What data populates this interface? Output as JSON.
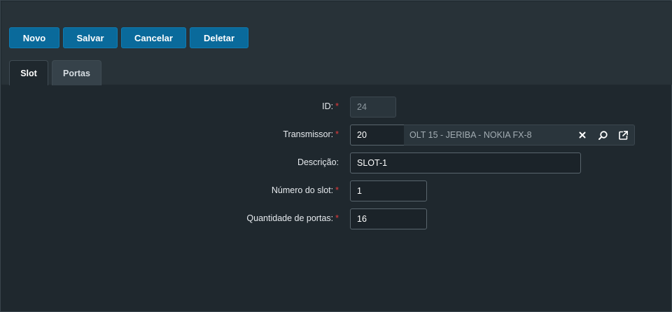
{
  "toolbar": {
    "novo_label": "Novo",
    "salvar_label": "Salvar",
    "cancelar_label": "Cancelar",
    "deletar_label": "Deletar"
  },
  "tabs": [
    {
      "label": "Slot",
      "active": true
    },
    {
      "label": "Portas",
      "active": false
    }
  ],
  "form": {
    "id": {
      "label": "ID:",
      "required": "*",
      "value": "24"
    },
    "transmissor": {
      "label": "Transmissor:",
      "required": "*",
      "value": "20",
      "description": "OLT 15 - JERIBA - NOKIA FX-8",
      "icons": [
        "clear-icon",
        "search-icon",
        "open-external-icon"
      ]
    },
    "descricao": {
      "label": "Descrição:",
      "value": "SLOT-1"
    },
    "numero_slot": {
      "label": "Número do slot:",
      "required": "*",
      "value": "1"
    },
    "quantidade_portas": {
      "label": "Quantidade de portas:",
      "required": "*",
      "value": "16"
    }
  },
  "colors": {
    "primary_button": "#0a6a9b",
    "required_marker": "#e33b3b",
    "background": "#1f282e"
  }
}
